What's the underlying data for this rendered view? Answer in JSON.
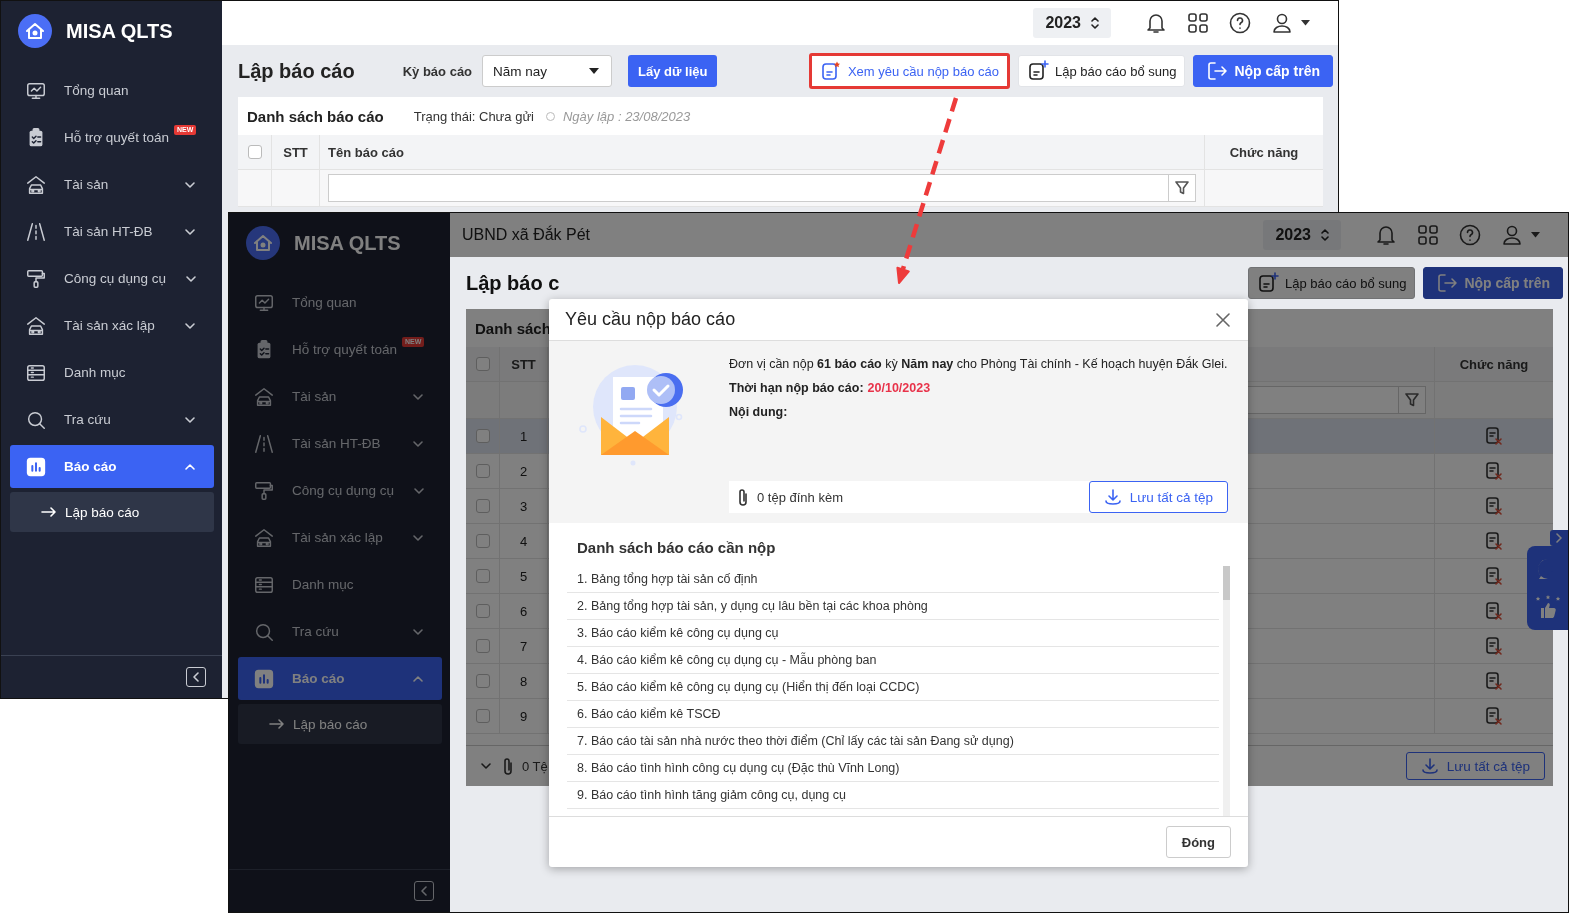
{
  "windows": [
    {
      "dimmed": false,
      "sidebar": {
        "app_name": "MISA QLTS",
        "items": [
          {
            "label": "Tổng quan",
            "selected": false
          },
          {
            "label": "Hỗ trợ quyết toán",
            "badge": "NEW",
            "selected": false
          },
          {
            "label": "Tài sản",
            "selected": false,
            "expanded": false
          },
          {
            "label": "Tài sản HT-ĐB",
            "selected": false,
            "expanded": false
          },
          {
            "label": "Công cụ dụng cụ",
            "selected": false,
            "expanded": false
          },
          {
            "label": "Tài sản xác lập",
            "selected": false,
            "expanded": false
          },
          {
            "label": "Danh mục",
            "selected": false
          },
          {
            "label": "Tra cứu",
            "selected": false,
            "expanded": false
          },
          {
            "label": "Báo cáo",
            "selected": true,
            "expanded": true,
            "children": [
              {
                "label": "Lập báo cáo",
                "selected": true
              }
            ]
          }
        ]
      },
      "header": {
        "year": "2023"
      },
      "toolbar": {
        "title": "Lập báo cáo",
        "period_label": "Kỳ báo cáo",
        "period": "Năm nay",
        "fetch_button": "Lấy dữ liệu",
        "actions": [
          {
            "label": "Xem yêu cầu nộp báo cáo",
            "kind": "link",
            "highlighted": true
          },
          {
            "label": "Lập báo cáo bổ sung",
            "kind": "outline",
            "highlighted": false
          },
          {
            "label": "Nộp cấp trên",
            "kind": "primary",
            "highlighted": false
          }
        ]
      },
      "report_list": {
        "title": "Danh sách báo cáo",
        "status": "Trạng thái: Chưa gửi",
        "created": "Ngày lập : 23/08/2023",
        "all_checked": false,
        "columns": {
          "number": "STT",
          "name": "Tên báo cáo",
          "actions": "Chức năng"
        }
      }
    },
    {
      "dimmed": true,
      "feedback_widget": true,
      "sidebar": {
        "app_name": "MISA QLTS",
        "items": [
          {
            "label": "Tổng quan",
            "selected": false
          },
          {
            "label": "Hỗ trợ quyết toán",
            "badge": "NEW",
            "selected": false
          },
          {
            "label": "Tài sản",
            "selected": false,
            "expanded": false
          },
          {
            "label": "Tài sản HT-ĐB",
            "selected": false,
            "expanded": false
          },
          {
            "label": "Công cụ dụng cụ",
            "selected": false,
            "expanded": false
          },
          {
            "label": "Tài sản xác lập",
            "selected": false,
            "expanded": false
          },
          {
            "label": "Danh mục",
            "selected": false
          },
          {
            "label": "Tra cứu",
            "selected": false,
            "expanded": false
          },
          {
            "label": "Báo cáo",
            "selected": true,
            "expanded": true,
            "children": [
              {
                "label": "Lập báo cáo",
                "selected": true
              }
            ]
          }
        ]
      },
      "header": {
        "unit": "UBND xã Đắk Pét",
        "year": "2023"
      },
      "toolbar": {
        "title": "Lập báo c",
        "actions": [
          {
            "label": "Lập báo cáo bổ sung",
            "kind": "outline",
            "highlighted": false
          },
          {
            "label": "Nộp cấp trên",
            "kind": "primary",
            "highlighted": false
          }
        ]
      },
      "report_list": {
        "title": "Danh sách",
        "all_checked": false,
        "columns": {
          "number": "STT",
          "actions": "Chức năng"
        },
        "rows": [
          {
            "number": "1",
            "selected": true,
            "checked": false
          },
          {
            "number": "2",
            "selected": false,
            "checked": false
          },
          {
            "number": "3",
            "selected": false,
            "checked": false
          },
          {
            "number": "4",
            "selected": false,
            "checked": false
          },
          {
            "number": "5",
            "selected": false,
            "checked": false
          },
          {
            "number": "6",
            "selected": false,
            "checked": false
          },
          {
            "number": "7",
            "selected": false,
            "checked": false
          },
          {
            "number": "8",
            "selected": false,
            "checked": false
          },
          {
            "number": "9",
            "selected": false,
            "checked": false
          }
        ],
        "footer": {
          "attachments": "0 Tệ",
          "save_button": "Lưu tất cả tệp"
        }
      },
      "modal": {
        "title": "Yêu cầu nộp báo cáo",
        "message": "Đơn vị cần nộp **61 báo cáo** kỳ **Năm nay** cho Phòng Tài chính - Kế hoạch huyện Đắk Glei.",
        "deadline_label": "Thời hạn nộp báo cáo:",
        "deadline": "20/10/2023",
        "content_label": "Nội dung:",
        "attachments": "0 tệp đính kèm",
        "save_button": "Lưu tất cả tệp",
        "list_title": "Danh sách báo cáo cần nộp",
        "reports": [
          "1. Bảng tổng hợp tài sản cố định",
          "2. Bảng tổng hợp tài sản, y dụng cụ lâu bền tại các khoa phòng",
          "3. Báo cáo kiểm kê công cụ dụng cụ",
          "4. Báo cáo kiểm kê công cụ dụng cụ - Mẫu phòng ban",
          "5. Báo cáo kiểm kê công cụ dụng cụ (Hiển thị đến loại CCDC)",
          "6. Báo cáo kiểm kê TSCĐ",
          "7. Báo cáo tài sản nhà nước theo thời điểm (Chỉ lấy các tài sản Đang sử dụng)",
          "8. Báo cáo tình hình công cụ dụng cụ (Đặc thù Vĩnh Long)",
          "9. Báo cáo tình hình tăng giảm công cụ, dụng cụ"
        ],
        "close_button": "Đóng"
      }
    }
  ]
}
